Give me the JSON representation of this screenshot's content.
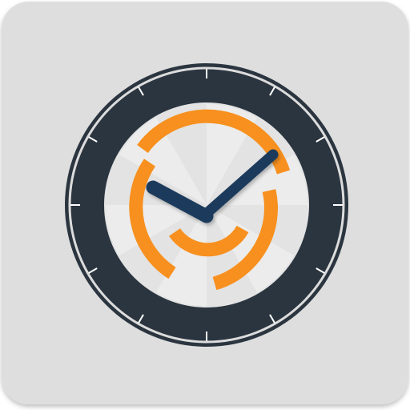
{
  "icon": {
    "name": "clock-app-icon",
    "colors": {
      "tile": "#dedede",
      "tile_shadow": "#c4c4c4",
      "outer_ring": "#2b3540",
      "bezel": "#dcdcdc",
      "tick": "#ffffff",
      "face": "#e3e3e3",
      "face_rays": "#ececec",
      "accent": "#f7901e",
      "hands": "#1f3a5c"
    },
    "time_shown": "10:10"
  }
}
